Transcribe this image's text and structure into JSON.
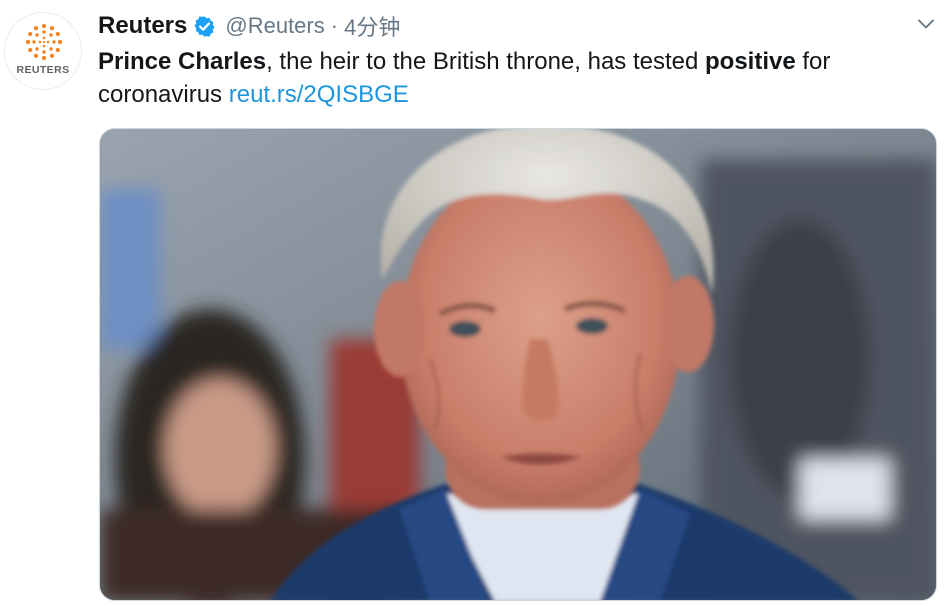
{
  "tweet": {
    "avatar_label": "REUTERS",
    "display_name": "Reuters",
    "handle": "@Reuters",
    "separator": "·",
    "timestamp": "4分钟",
    "text_bold_1": "Prince Charles",
    "text_plain_1": ", the heir to the British throne, has tested ",
    "text_bold_2": "positive",
    "text_plain_2": " for coronavirus ",
    "link": "reut.rs/2QISBGE"
  },
  "colors": {
    "accent": "#1da1f2",
    "link": "#1b95e0",
    "secondary_text": "#657786",
    "reuters_orange": "#f48221"
  },
  "icons": {
    "verified": "verified-badge-icon",
    "caret": "chevron-down-icon",
    "logo": "reuters-logo-dots-icon"
  }
}
